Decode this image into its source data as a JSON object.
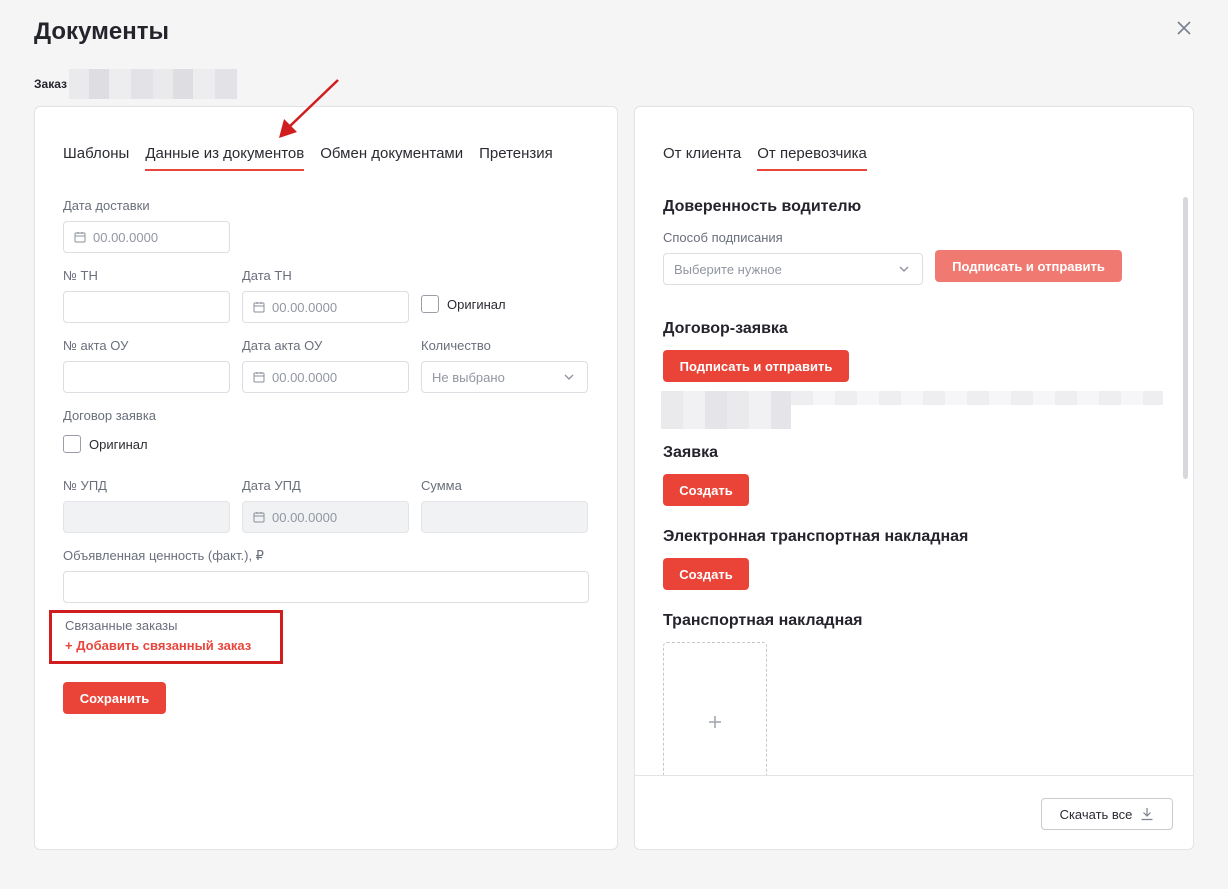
{
  "header": {
    "title": "Документы",
    "order_label": "Заказ"
  },
  "left": {
    "tabs": [
      "Шаблоны",
      "Данные из документов",
      "Обмен документами",
      "Претензия"
    ],
    "active_tab": 1,
    "delivery_date": {
      "label": "Дата доставки",
      "placeholder": "00.00.0000"
    },
    "tn_number": {
      "label": "№ ТН",
      "value": ""
    },
    "tn_date": {
      "label": "Дата ТН",
      "placeholder": "00.00.0000"
    },
    "original_1": {
      "label": "Оригинал",
      "checked": false
    },
    "act_number": {
      "label": "№ акта ОУ",
      "value": ""
    },
    "act_date": {
      "label": "Дата акта ОУ",
      "placeholder": "00.00.0000"
    },
    "quantity": {
      "label": "Количество",
      "value": "Не выбрано"
    },
    "contract": {
      "label": "Договор заявка"
    },
    "original_2": {
      "label": "Оригинал",
      "checked": false
    },
    "upd_number": {
      "label": "№ УПД",
      "value": ""
    },
    "upd_date": {
      "label": "Дата УПД",
      "placeholder": "00.00.0000"
    },
    "sum": {
      "label": "Сумма",
      "value": ""
    },
    "declared_value": {
      "label": "Объявленная ценность (факт.), ₽",
      "value": ""
    },
    "linked_orders": {
      "label": "Связанные заказы",
      "add_link": "+ Добавить связанный заказ"
    },
    "save_button": "Сохранить"
  },
  "right": {
    "tabs": [
      "От клиента",
      "От перевозчика"
    ],
    "active_tab": 1,
    "driver_poa": {
      "title": "Доверенность водителю",
      "method_label": "Способ подписания",
      "method_placeholder": "Выберите нужное",
      "sign_button": "Подписать и отправить"
    },
    "contract_request": {
      "title": "Договор-заявка",
      "sign_button": "Подписать и отправить"
    },
    "request": {
      "title": "Заявка",
      "create_button": "Создать"
    },
    "etn": {
      "title": "Электронная транспортная накладная",
      "create_button": "Создать"
    },
    "tn": {
      "title": "Транспортная накладная"
    },
    "download_all": "Скачать все"
  },
  "colors": {
    "accent": "#ea4438",
    "accent_faded": "#f07a72",
    "highlight_border": "#d01e1e"
  }
}
